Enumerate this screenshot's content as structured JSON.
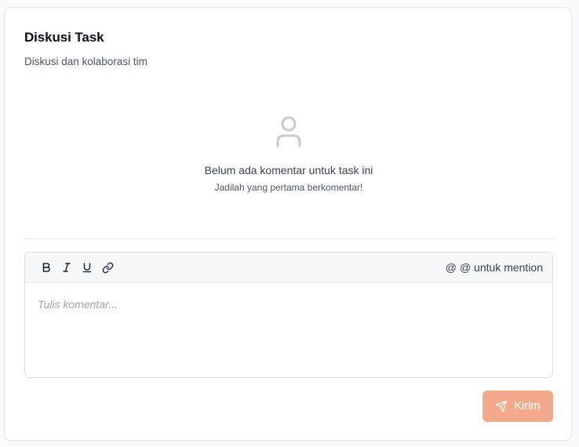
{
  "header": {
    "title": "Diskusi Task",
    "subtitle": "Diskusi dan kolaborasi tim"
  },
  "empty_state": {
    "icon": "user-icon",
    "message": "Belum ada komentar untuk task ini",
    "hint": "Jadilah yang pertama berkomentar!"
  },
  "editor": {
    "toolbar": {
      "bold_label": "B",
      "italic_label": "I",
      "underline_label": "U",
      "link_icon": "link-icon",
      "mention_symbol": "@",
      "mention_hint": "@ untuk mention"
    },
    "placeholder": "Tulis komentar...",
    "value": ""
  },
  "actions": {
    "send_label": "Kirim",
    "send_icon": "send-icon"
  },
  "colors": {
    "accent_disabled": "#f4a98c",
    "border": "#e5e7eb",
    "toolbar_bg": "#f6f7f9"
  }
}
